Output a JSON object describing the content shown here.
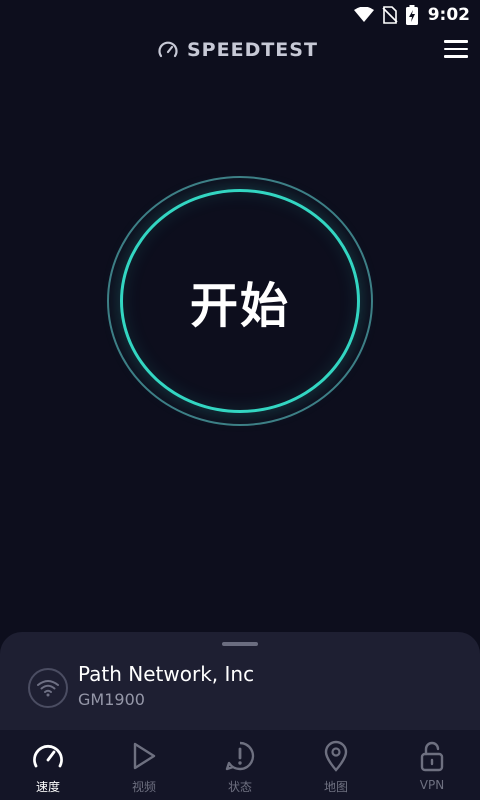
{
  "status_bar": {
    "time": "9:02",
    "icons": [
      "wifi-icon",
      "no-sim-icon",
      "battery-charging-icon"
    ]
  },
  "header": {
    "brand": "SPEEDTEST",
    "brand_icon": "speedometer-icon",
    "menu_icon": "hamburger-menu-icon"
  },
  "go_button": {
    "label": "开始"
  },
  "connection": {
    "isp": "Path Network, Inc",
    "device": "GM1900",
    "icon": "wifi-icon"
  },
  "nav": {
    "items": [
      {
        "label": "速度",
        "icon": "speedometer-icon",
        "active": true
      },
      {
        "label": "视频",
        "icon": "play-icon",
        "active": false
      },
      {
        "label": "状态",
        "icon": "alert-icon",
        "active": false
      },
      {
        "label": "地图",
        "icon": "map-pin-icon",
        "active": false
      },
      {
        "label": "VPN",
        "icon": "lock-icon",
        "active": false
      }
    ]
  },
  "colors": {
    "background": "#0d0e1d",
    "accent": "#33d6c2",
    "sheet": "#1e1f32",
    "nav_bg": "#141527"
  }
}
